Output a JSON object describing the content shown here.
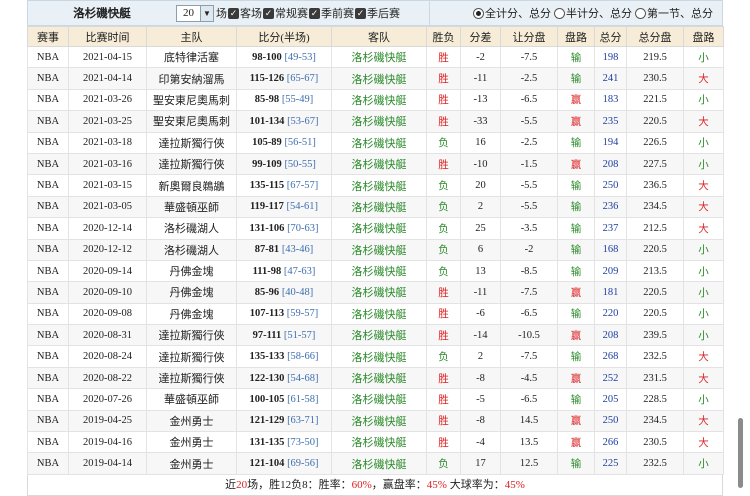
{
  "toolbar": {
    "title": "洛杉磯快艇",
    "count_select": "20",
    "count_unit": "场",
    "checks": [
      "客场",
      "常规赛",
      "季前赛",
      "季后赛"
    ],
    "radios": [
      {
        "label": "全计分、总分",
        "selected": true
      },
      {
        "label": "半计分、总分",
        "selected": false
      },
      {
        "label": "第一节、总分",
        "selected": false
      }
    ]
  },
  "headers": [
    "赛事",
    "比赛时间",
    "主队",
    "比分(半场)",
    "客队",
    "胜负",
    "分差",
    "让分盘",
    "盘路",
    "总分",
    "总分盘",
    "盘路"
  ],
  "rows": [
    {
      "league": "NBA",
      "date": "2021-04-15",
      "home": "底特律活塞",
      "score": "98-100",
      "half": "[49-53]",
      "away": "洛杉磯快艇",
      "result": "胜",
      "diff": "-2",
      "handicap": "-7.5",
      "hc_res": "输",
      "total": "198",
      "total_line": "219.5",
      "ou": "小"
    },
    {
      "league": "NBA",
      "date": "2021-04-14",
      "home": "印第安納溜馬",
      "score": "115-126",
      "half": "[65-67]",
      "away": "洛杉磯快艇",
      "result": "胜",
      "diff": "-11",
      "handicap": "-2.5",
      "hc_res": "输",
      "total": "241",
      "total_line": "230.5",
      "ou": "大"
    },
    {
      "league": "NBA",
      "date": "2021-03-26",
      "home": "聖安東尼奧馬刺",
      "score": "85-98",
      "half": "[55-49]",
      "away": "洛杉磯快艇",
      "result": "胜",
      "diff": "-13",
      "handicap": "-6.5",
      "hc_res": "赢",
      "total": "183",
      "total_line": "221.5",
      "ou": "小"
    },
    {
      "league": "NBA",
      "date": "2021-03-25",
      "home": "聖安東尼奧馬刺",
      "score": "101-134",
      "half": "[53-67]",
      "away": "洛杉磯快艇",
      "result": "胜",
      "diff": "-33",
      "handicap": "-5.5",
      "hc_res": "赢",
      "total": "235",
      "total_line": "220.5",
      "ou": "大"
    },
    {
      "league": "NBA",
      "date": "2021-03-18",
      "home": "達拉斯獨行俠",
      "score": "105-89",
      "half": "[56-51]",
      "away": "洛杉磯快艇",
      "result": "负",
      "diff": "16",
      "handicap": "-2.5",
      "hc_res": "输",
      "total": "194",
      "total_line": "226.5",
      "ou": "小"
    },
    {
      "league": "NBA",
      "date": "2021-03-16",
      "home": "達拉斯獨行俠",
      "score": "99-109",
      "half": "[50-55]",
      "away": "洛杉磯快艇",
      "result": "胜",
      "diff": "-10",
      "handicap": "-1.5",
      "hc_res": "赢",
      "total": "208",
      "total_line": "227.5",
      "ou": "小"
    },
    {
      "league": "NBA",
      "date": "2021-03-15",
      "home": "新奧爾良鵜鶘",
      "score": "135-115",
      "half": "[67-57]",
      "away": "洛杉磯快艇",
      "result": "负",
      "diff": "20",
      "handicap": "-5.5",
      "hc_res": "输",
      "total": "250",
      "total_line": "236.5",
      "ou": "大"
    },
    {
      "league": "NBA",
      "date": "2021-03-05",
      "home": "華盛頓巫師",
      "score": "119-117",
      "half": "[54-61]",
      "away": "洛杉磯快艇",
      "result": "负",
      "diff": "2",
      "handicap": "-5.5",
      "hc_res": "输",
      "total": "236",
      "total_line": "234.5",
      "ou": "大"
    },
    {
      "league": "NBA",
      "date": "2020-12-14",
      "home": "洛杉磯湖人",
      "score": "131-106",
      "half": "[70-63]",
      "away": "洛杉磯快艇",
      "result": "负",
      "diff": "25",
      "handicap": "-3.5",
      "hc_res": "输",
      "total": "237",
      "total_line": "212.5",
      "ou": "大"
    },
    {
      "league": "NBA",
      "date": "2020-12-12",
      "home": "洛杉磯湖人",
      "score": "87-81",
      "half": "[43-46]",
      "away": "洛杉磯快艇",
      "result": "负",
      "diff": "6",
      "handicap": "-2",
      "hc_res": "输",
      "total": "168",
      "total_line": "220.5",
      "ou": "小"
    },
    {
      "league": "NBA",
      "date": "2020-09-14",
      "home": "丹佛金塊",
      "score": "111-98",
      "half": "[47-63]",
      "away": "洛杉磯快艇",
      "result": "负",
      "diff": "13",
      "handicap": "-8.5",
      "hc_res": "输",
      "total": "209",
      "total_line": "213.5",
      "ou": "小"
    },
    {
      "league": "NBA",
      "date": "2020-09-10",
      "home": "丹佛金塊",
      "score": "85-96",
      "half": "[40-48]",
      "away": "洛杉磯快艇",
      "result": "胜",
      "diff": "-11",
      "handicap": "-7.5",
      "hc_res": "赢",
      "total": "181",
      "total_line": "220.5",
      "ou": "小"
    },
    {
      "league": "NBA",
      "date": "2020-09-08",
      "home": "丹佛金塊",
      "score": "107-113",
      "half": "[59-57]",
      "away": "洛杉磯快艇",
      "result": "胜",
      "diff": "-6",
      "handicap": "-6.5",
      "hc_res": "输",
      "total": "220",
      "total_line": "220.5",
      "ou": "小"
    },
    {
      "league": "NBA",
      "date": "2020-08-31",
      "home": "達拉斯獨行俠",
      "score": "97-111",
      "half": "[51-57]",
      "away": "洛杉磯快艇",
      "result": "胜",
      "diff": "-14",
      "handicap": "-10.5",
      "hc_res": "赢",
      "total": "208",
      "total_line": "239.5",
      "ou": "小"
    },
    {
      "league": "NBA",
      "date": "2020-08-24",
      "home": "達拉斯獨行俠",
      "score": "135-133",
      "half": "[58-66]",
      "away": "洛杉磯快艇",
      "result": "负",
      "diff": "2",
      "handicap": "-7.5",
      "hc_res": "输",
      "total": "268",
      "total_line": "232.5",
      "ou": "大"
    },
    {
      "league": "NBA",
      "date": "2020-08-22",
      "home": "達拉斯獨行俠",
      "score": "122-130",
      "half": "[54-68]",
      "away": "洛杉磯快艇",
      "result": "胜",
      "diff": "-8",
      "handicap": "-4.5",
      "hc_res": "赢",
      "total": "252",
      "total_line": "231.5",
      "ou": "大"
    },
    {
      "league": "NBA",
      "date": "2020-07-26",
      "home": "華盛頓巫師",
      "score": "100-105",
      "half": "[61-58]",
      "away": "洛杉磯快艇",
      "result": "胜",
      "diff": "-5",
      "handicap": "-6.5",
      "hc_res": "输",
      "total": "205",
      "total_line": "228.5",
      "ou": "小"
    },
    {
      "league": "NBA",
      "date": "2019-04-25",
      "home": "金州勇士",
      "score": "121-129",
      "half": "[63-71]",
      "away": "洛杉磯快艇",
      "result": "胜",
      "diff": "-8",
      "handicap": "14.5",
      "hc_res": "赢",
      "total": "250",
      "total_line": "234.5",
      "ou": "大"
    },
    {
      "league": "NBA",
      "date": "2019-04-16",
      "home": "金州勇士",
      "score": "131-135",
      "half": "[73-50]",
      "away": "洛杉磯快艇",
      "result": "胜",
      "diff": "-4",
      "handicap": "13.5",
      "hc_res": "赢",
      "total": "266",
      "total_line": "230.5",
      "ou": "大"
    },
    {
      "league": "NBA",
      "date": "2019-04-14",
      "home": "金州勇士",
      "score": "121-104",
      "half": "[69-56]",
      "away": "洛杉磯快艇",
      "result": "负",
      "diff": "17",
      "handicap": "12.5",
      "hc_res": "输",
      "total": "225",
      "total_line": "232.5",
      "ou": "小"
    }
  ],
  "footer": {
    "prefix": "近",
    "games": "20",
    "mid1": "场，胜12负8：胜率：",
    "win_rate": "60%",
    "mid2": "，赢盘率：",
    "cover_rate": "45%",
    "mid3": " 大球率为：",
    "over_rate": "45%"
  }
}
